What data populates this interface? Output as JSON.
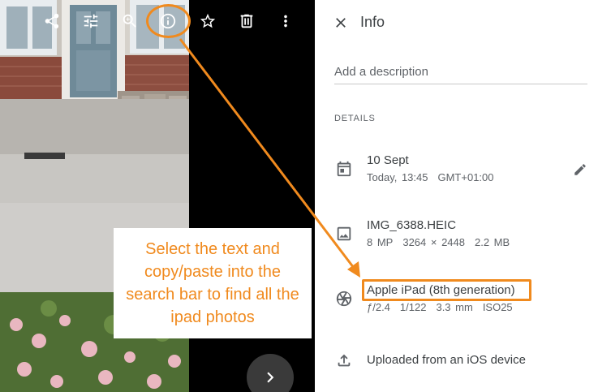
{
  "toolbar": {
    "share_icon": "share-icon",
    "adjust_icon": "tune-icon",
    "zoom_icon": "zoom-in-icon",
    "info_icon": "info-icon",
    "favorite_icon": "star-icon",
    "delete_icon": "trash-icon",
    "more_icon": "more-vert-icon"
  },
  "viewer": {
    "next_icon": "chevron-right-icon"
  },
  "panel": {
    "title": "Info",
    "description_placeholder": "Add a description",
    "details_heading": "DETAILS",
    "date": {
      "main": "10 Sept",
      "day_time": "Today, 13:45",
      "timezone": "GMT+01:00",
      "edit_icon": "pencil-icon"
    },
    "file": {
      "name": "IMG_6388.HEIC",
      "megapixels": "8 MP",
      "resolution": "3264 × 2448",
      "size": "2.2 MB"
    },
    "camera": {
      "model": "Apple iPad (8th generation)",
      "aperture": "ƒ/2.4",
      "shutter": "1/122",
      "focal_length": "3.3 mm",
      "iso": "ISO25"
    },
    "upload": {
      "source": "Uploaded from an iOS device"
    }
  },
  "annotation": {
    "callout": "Select the text and copy/paste into the search bar to find all the ipad photos",
    "color": "#f08a1e"
  }
}
